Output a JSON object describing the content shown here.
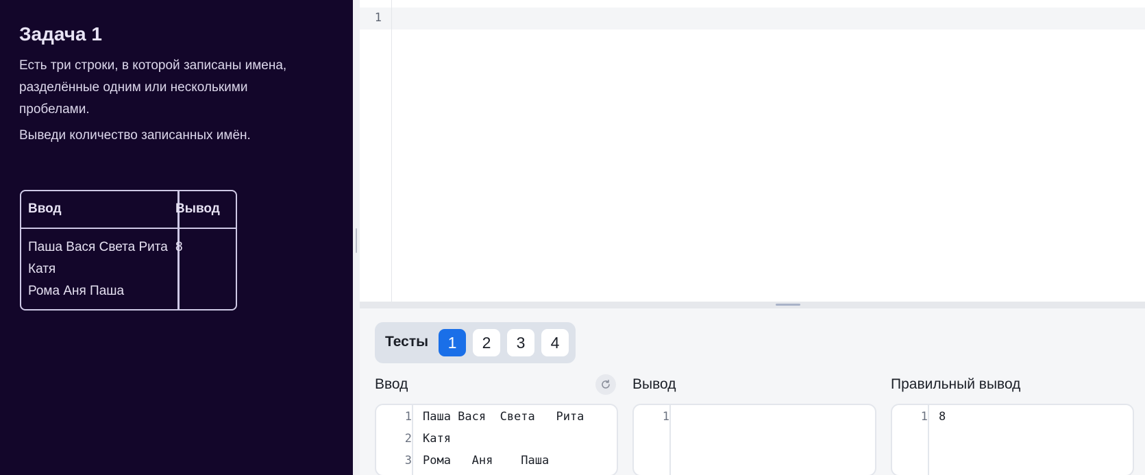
{
  "task": {
    "title": "Задача 1",
    "paragraphs": [
      "Есть три строки, в которой записаны имена, разделённые одним или несколькими пробелами.",
      "Выведи количество записанных имён."
    ],
    "example": {
      "input_header": "Ввод",
      "output_header": "Вывод",
      "input_value": "Паша Вася Света Рита\nКатя\nРома Аня Паша",
      "output_value": "8"
    }
  },
  "editor": {
    "line_numbers": [
      "1"
    ]
  },
  "tests": {
    "label": "Тесты",
    "buttons": [
      "1",
      "2",
      "3",
      "4"
    ],
    "active_index": 0
  },
  "io": {
    "input_label": "Ввод",
    "output_label": "Вывод",
    "expected_label": "Правильный вывод",
    "refresh_icon": "refresh-icon",
    "input": {
      "line_numbers": [
        "1",
        "2",
        "3"
      ],
      "lines": [
        "Паша Вася  Света   Рита",
        "Катя",
        "Рома   Аня    Паша"
      ]
    },
    "output": {
      "line_numbers": [
        "1"
      ],
      "lines": [
        ""
      ]
    },
    "expected": {
      "line_numbers": [
        "1"
      ],
      "lines": [
        "8"
      ]
    }
  },
  "colors": {
    "task_bg": "#13062a",
    "accent": "#1a6fe8"
  }
}
